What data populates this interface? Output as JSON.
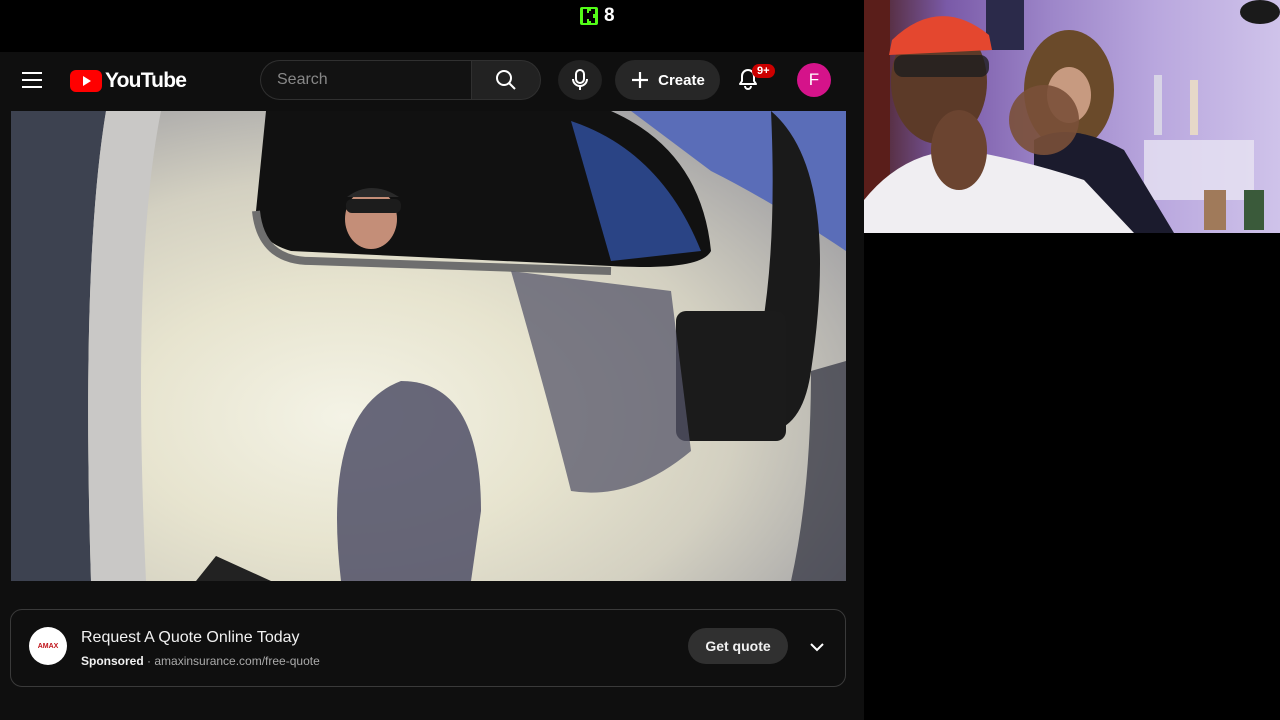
{
  "stream": {
    "viewer_count": "8",
    "kick_icon": "kick-logo-icon",
    "accent": "#53fc18"
  },
  "youtube": {
    "logo_text": "YouTube",
    "search": {
      "placeholder": "Search"
    },
    "create_label": "Create",
    "notifications_badge": "9+",
    "avatar_letter": "F",
    "avatar_color": "#d5138a",
    "brand_red": "#ff0000"
  },
  "ad": {
    "title": "Request A Quote Online Today",
    "sponsored_label": "Sponsored",
    "separator": " · ",
    "url": "amaxinsurance.com/free-quote",
    "cta": "Get quote",
    "logo_text": "AMAX"
  }
}
